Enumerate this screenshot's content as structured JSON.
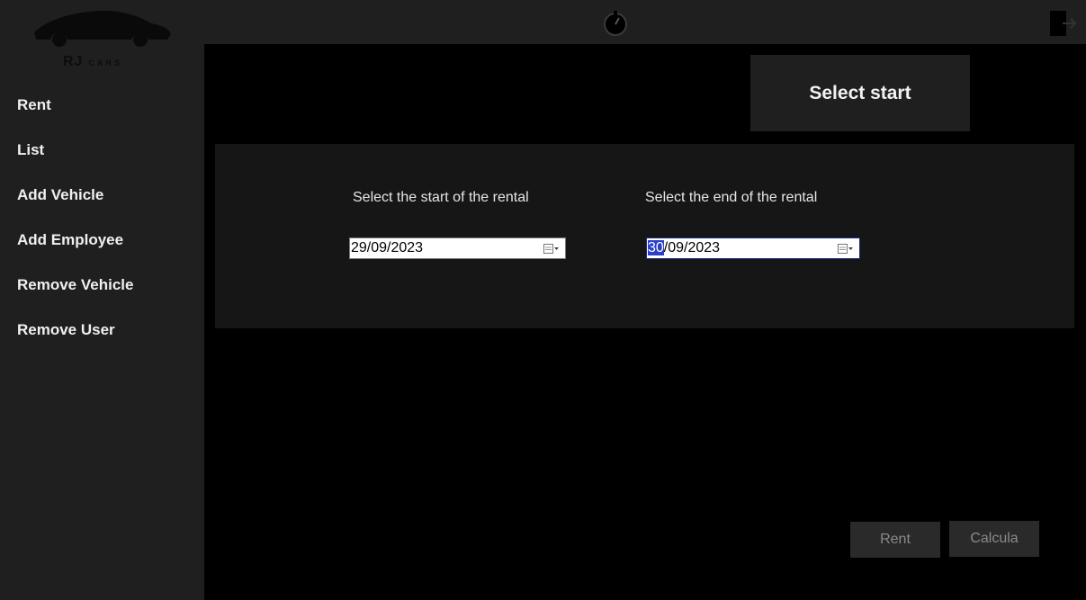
{
  "brand": {
    "name": "RJ",
    "sub": "CARS"
  },
  "nav": {
    "items": [
      {
        "label": "Rent"
      },
      {
        "label": "List"
      },
      {
        "label": "Add Vehicle"
      },
      {
        "label": "Add Employee"
      },
      {
        "label": "Remove Vehicle"
      },
      {
        "label": "Remove User"
      }
    ]
  },
  "header": {
    "select_start": "Select start"
  },
  "rental": {
    "start_label": "Select the start of the rental",
    "end_label": "Select the end of the rental",
    "start_date": "29/09/2023",
    "end_date_day": "30",
    "end_date_rest": "/09/2023"
  },
  "actions": {
    "rent_label": "Rent",
    "calculate_label": "Calcula"
  },
  "icons": {
    "timer": "stopwatch-icon",
    "exit": "logout-icon",
    "calendar": "calendar-icon"
  }
}
